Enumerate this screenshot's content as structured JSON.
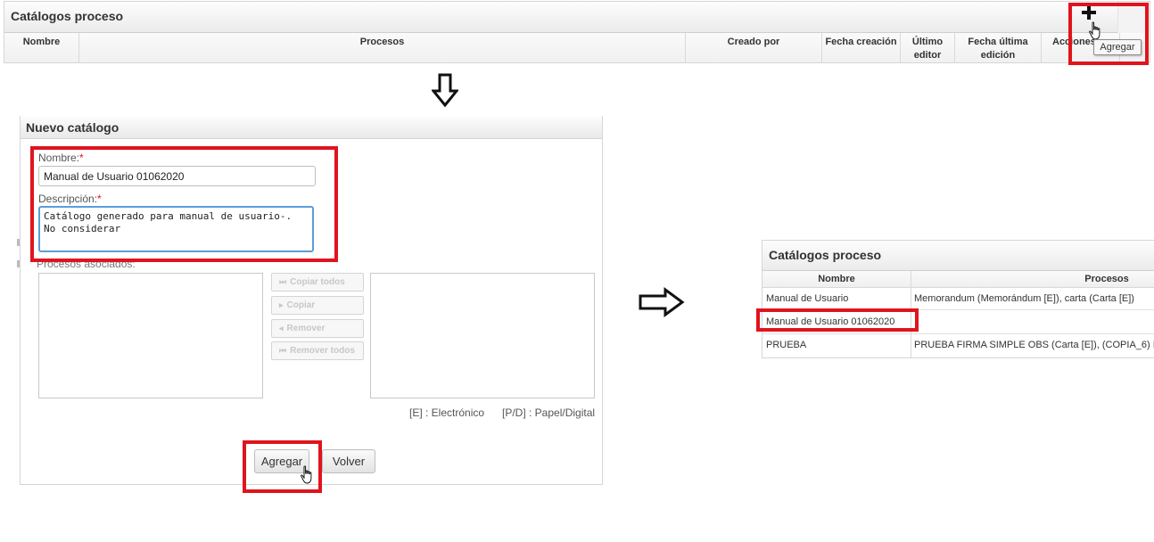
{
  "catalog_list": {
    "title": "Catálogos proceso",
    "columns": [
      "Nombre",
      "Procesos",
      "Creado por",
      "Fecha creación",
      "Último editor",
      "Fecha última edición",
      "Acciones"
    ],
    "add_tooltip": "Agregar",
    "add_icon": "plus-icon"
  },
  "new_catalog_form": {
    "title": "Nuevo catálogo",
    "name_label": "Nombre:",
    "name_value": "Manual de Usuario 01062020",
    "description_label": "Descripción:",
    "description_value": "Catálogo generado para manual de usuario-. No considerar",
    "associated_label": "Procesos asociados:",
    "move_buttons": {
      "copy_all": "Copiar todos",
      "copy": "Copiar",
      "remove": "Remover",
      "remove_all": "Remover todos"
    },
    "legend_electronic": "[E] : Electrónico",
    "legend_paper": "[P/D] : Papel/Digital",
    "add_button": "Agregar",
    "back_button": "Volver"
  },
  "result_list": {
    "title": "Catálogos proceso",
    "columns": [
      "Nombre",
      "Procesos"
    ],
    "rows": [
      {
        "name": "Manual de Usuario",
        "processes": "Memorandum (Memorándum [E]), carta (Carta [E])"
      },
      {
        "name": "Manual de Usuario 01062020",
        "processes": ""
      },
      {
        "name": "PRUEBA",
        "processes": "PRUEBA FIRMA SIMPLE OBS (Carta [E]), (COPIA_6) I"
      }
    ]
  },
  "colors": {
    "highlight": "#e0141e",
    "focus_border": "#5b9ddb"
  }
}
